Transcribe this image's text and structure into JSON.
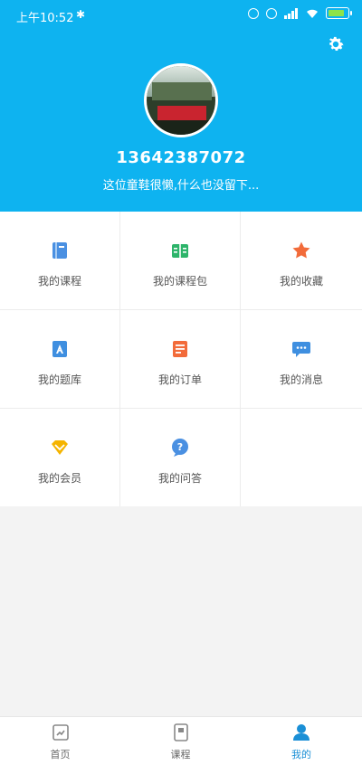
{
  "status_bar": {
    "time": "上午10:52"
  },
  "profile": {
    "phone": "13642387072",
    "bio": "这位童鞋很懒,什么也没留下..."
  },
  "menu": [
    {
      "label": "我的课程",
      "icon": "course-book-icon",
      "color": "#4a90e2"
    },
    {
      "label": "我的课程包",
      "icon": "course-package-icon",
      "color": "#2db46a"
    },
    {
      "label": "我的收藏",
      "icon": "star-icon",
      "color": "#f26b3a"
    },
    {
      "label": "我的题库",
      "icon": "question-bank-icon",
      "color": "#3f8fe0"
    },
    {
      "label": "我的订单",
      "icon": "order-icon",
      "color": "#f26b3a"
    },
    {
      "label": "我的消息",
      "icon": "message-icon",
      "color": "#3f8fe0"
    },
    {
      "label": "我的会员",
      "icon": "vip-icon",
      "color": "#f5b400"
    },
    {
      "label": "我的问答",
      "icon": "qa-icon",
      "color": "#4a90e2"
    }
  ],
  "tabs": [
    {
      "label": "首页",
      "icon": "home-icon"
    },
    {
      "label": "课程",
      "icon": "course-icon"
    },
    {
      "label": "我的",
      "icon": "profile-icon",
      "active": true
    }
  ],
  "colors": {
    "header_bg": "#0eb3f0",
    "active_tab": "#1a8fd6"
  }
}
